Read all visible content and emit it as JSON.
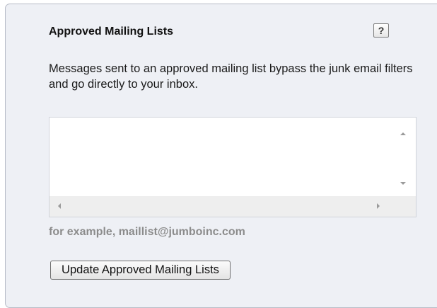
{
  "section": {
    "title": "Approved Mailing Lists",
    "help_label": "?",
    "description": "Messages sent to an approved mailing list bypass the junk email filters and go directly to your inbox.",
    "list_items": [],
    "example_text": "for example, maillist@jumboinc.com",
    "update_button_label": "Update Approved Mailing Lists"
  }
}
